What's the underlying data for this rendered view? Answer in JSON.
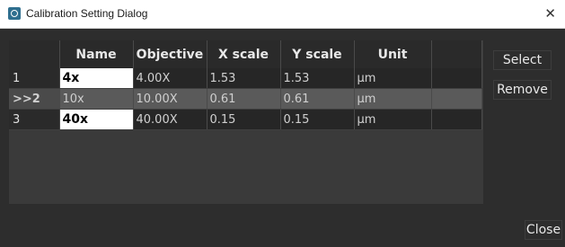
{
  "window": {
    "title": "Calibration Setting Dialog"
  },
  "table": {
    "columns": [
      "",
      "Name",
      "Objective",
      "X scale",
      "Y scale",
      "Unit",
      ""
    ],
    "rows": [
      {
        "num": "1",
        "name": "4x",
        "objective": "4.00X",
        "x_scale": "1.53",
        "y_scale": "1.53",
        "unit": "µm"
      },
      {
        "num": ">>2",
        "name": "10x",
        "objective": "10.00X",
        "x_scale": "0.61",
        "y_scale": "0.61",
        "unit": "µm"
      },
      {
        "num": "3",
        "name": "40x",
        "objective": "40.00X",
        "x_scale": "0.15",
        "y_scale": "0.15",
        "unit": "µm"
      }
    ]
  },
  "buttons": {
    "select": "Select",
    "remove": "Remove",
    "close": "Close"
  },
  "icons": {
    "app": "app-icon",
    "close": "close-icon"
  }
}
